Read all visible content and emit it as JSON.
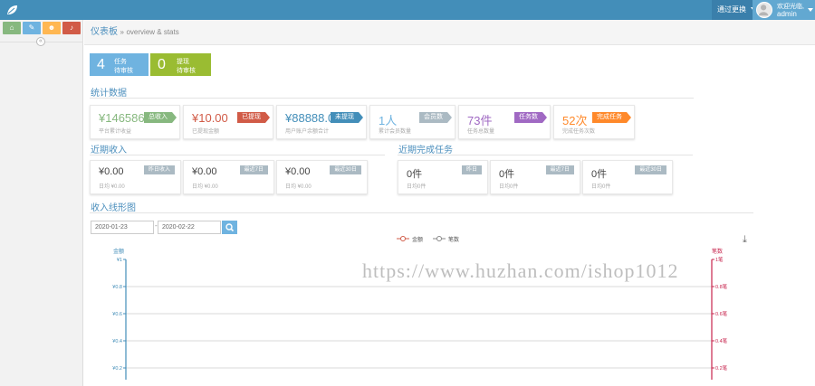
{
  "header": {
    "theme_button": "通过更换",
    "user_welcome": "欢迎光临,",
    "user_name": "admin"
  },
  "sidebar": {
    "shortcuts": [
      {
        "icon": "home-icon",
        "glyph": "⌂",
        "color": "#87b87f"
      },
      {
        "icon": "pencil-icon",
        "glyph": "✎",
        "color": "#6fb3e0"
      },
      {
        "icon": "users-icon",
        "glyph": "☻",
        "color": "#ffb752"
      },
      {
        "icon": "bell-icon",
        "glyph": "♪",
        "color": "#d15b47"
      }
    ],
    "collapse_glyph": "«"
  },
  "breadcrumb": {
    "home": "仪表板",
    "separator": "»",
    "sub": "overview & stats"
  },
  "infoboxes": [
    {
      "value": "4",
      "line1": "任务",
      "line2": "待审核",
      "color": "#6fb3e0"
    },
    {
      "value": "0",
      "line1": "提现",
      "line2": "待审核",
      "color": "#9abc32"
    }
  ],
  "stats": {
    "title": "统计数据",
    "items": [
      {
        "value": "¥146586.0",
        "label": "平台累计收益",
        "badge": "总收入",
        "val_color": "#87b87f",
        "badge_color": "#87b87f"
      },
      {
        "value": "¥10.00",
        "label": "已提现金额",
        "badge": "已提现",
        "val_color": "#d15b47",
        "badge_color": "#d15b47"
      },
      {
        "value": "¥88888.00",
        "label": "用户账户余额合计",
        "badge": "未提现",
        "val_color": "#438eb9",
        "badge_color": "#438eb9"
      },
      {
        "value": "1人",
        "label": "累计会员数量",
        "badge": "会员数",
        "val_color": "#6fb3e0",
        "badge_color": "#abbac3"
      },
      {
        "value": "73件",
        "label": "任务总数量",
        "badge": "任务数",
        "val_color": "#a069c3",
        "badge_color": "#a069c3"
      },
      {
        "value": "52次",
        "label": "完成任务次数",
        "badge": "完成任务",
        "val_color": "#ff892a",
        "badge_color": "#ff892a"
      }
    ]
  },
  "recent_income": {
    "title": "近期收入",
    "items": [
      {
        "value": "¥0.00",
        "label": "日均 ¥0.00",
        "badge": "昨日收入"
      },
      {
        "value": "¥0.00",
        "label": "日均 ¥0.00",
        "badge": "最近7日"
      },
      {
        "value": "¥0.00",
        "label": "日均 ¥0.00",
        "badge": "最近30日"
      }
    ]
  },
  "recent_tasks": {
    "title": "近期完成任务",
    "items": [
      {
        "value": "0件",
        "label": "日均0件",
        "badge": "昨日"
      },
      {
        "value": "0件",
        "label": "日均0件",
        "badge": "最近7日"
      },
      {
        "value": "0件",
        "label": "日均0件",
        "badge": "最近30日"
      }
    ]
  },
  "chart_section": {
    "title": "收入线形图",
    "date_from": "2020-01-23",
    "date_to": "2020-02-22",
    "date_sep": "-",
    "download_glyph": "⤓"
  },
  "chart_data": {
    "type": "line",
    "legend": [
      "金额",
      "笔数"
    ],
    "legend_colors": [
      "#d15b47",
      "#888888"
    ],
    "legend_placement": "top-center",
    "left_axis": {
      "label": "金额",
      "color": "#438eb9",
      "ticks": [
        "¥1",
        "¥0.8",
        "¥0.6",
        "¥0.4",
        "¥0.2"
      ],
      "ylim": [
        0,
        1
      ]
    },
    "right_axis": {
      "label": "笔数",
      "color": "#c7254e",
      "ticks": [
        "1笔",
        "0.8笔",
        "0.6笔",
        "0.4笔",
        "0.2笔"
      ],
      "ylim": [
        0,
        1
      ]
    },
    "grid": true,
    "series": []
  },
  "watermark": "https://www.huzhan.com/ishop1012"
}
